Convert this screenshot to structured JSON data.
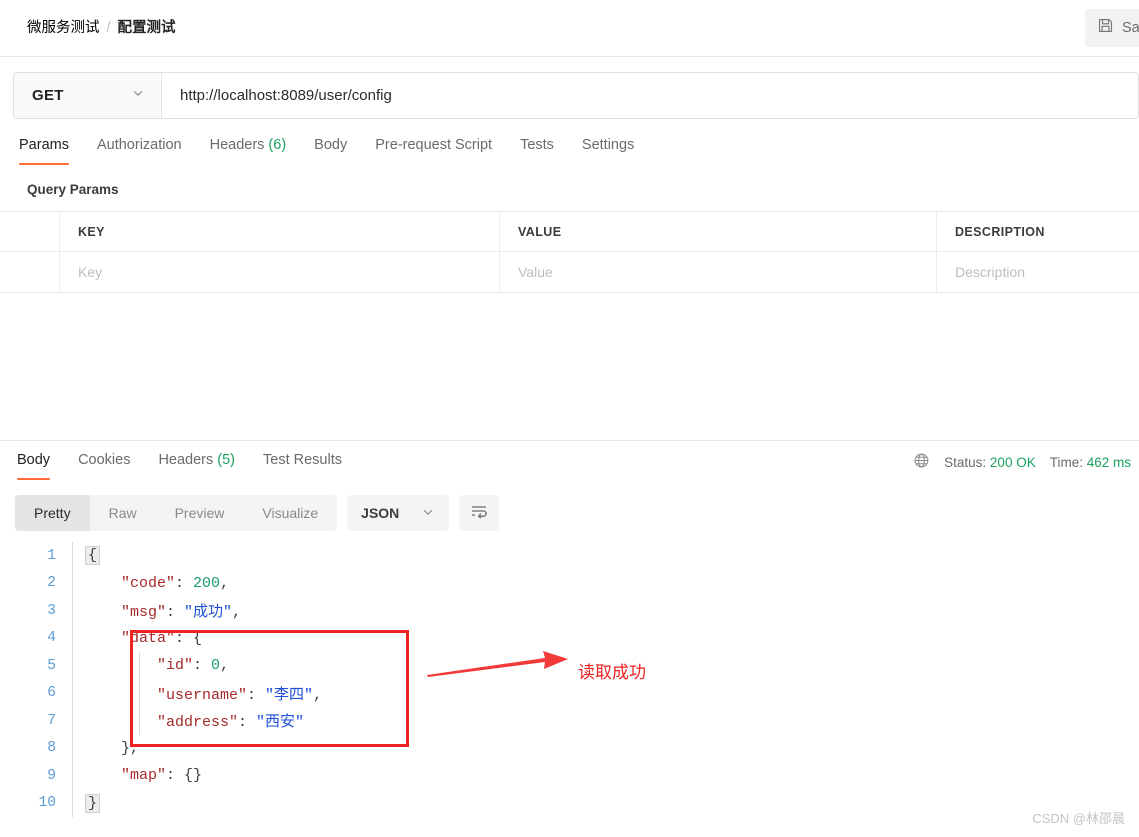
{
  "header": {
    "breadcrumb_parent": "微服务测试",
    "breadcrumb_separator": "/",
    "breadcrumb_current": "配置测试",
    "save_label": "Sa"
  },
  "request": {
    "method": "GET",
    "url": "http://localhost:8089/user/config",
    "tabs": [
      {
        "label": "Params",
        "count": "",
        "active": true
      },
      {
        "label": "Authorization",
        "count": "",
        "active": false
      },
      {
        "label": "Headers",
        "count": "(6)",
        "active": false
      },
      {
        "label": "Body",
        "count": "",
        "active": false
      },
      {
        "label": "Pre-request Script",
        "count": "",
        "active": false
      },
      {
        "label": "Tests",
        "count": "",
        "active": false
      },
      {
        "label": "Settings",
        "count": "",
        "active": false
      }
    ],
    "query_params": {
      "title": "Query Params",
      "columns": [
        "KEY",
        "VALUE",
        "DESCRIPTION"
      ],
      "rows": [
        {
          "key": "Key",
          "value": "Value",
          "description": "Description"
        }
      ]
    }
  },
  "response": {
    "tabs": [
      {
        "label": "Body",
        "count": "",
        "active": true
      },
      {
        "label": "Cookies",
        "count": "",
        "active": false
      },
      {
        "label": "Headers",
        "count": "(5)",
        "active": false
      },
      {
        "label": "Test Results",
        "count": "",
        "active": false
      }
    ],
    "status_label": "Status:",
    "status_value": "200 OK",
    "time_label": "Time:",
    "time_value": "462 ms",
    "format_tabs": [
      {
        "label": "Pretty",
        "active": true
      },
      {
        "label": "Raw",
        "active": false
      },
      {
        "label": "Preview",
        "active": false
      },
      {
        "label": "Visualize",
        "active": false
      }
    ],
    "format_select": "JSON",
    "body_lines": [
      {
        "n": "1",
        "segments": [
          {
            "t": "{",
            "c": "brace"
          }
        ]
      },
      {
        "n": "2",
        "segments": [
          {
            "t": "    ",
            "c": "pun"
          },
          {
            "t": "\"code\"",
            "c": "k"
          },
          {
            "t": ": ",
            "c": "pun"
          },
          {
            "t": "200",
            "c": "num"
          },
          {
            "t": ",",
            "c": "pun"
          }
        ]
      },
      {
        "n": "3",
        "segments": [
          {
            "t": "    ",
            "c": "pun"
          },
          {
            "t": "\"msg\"",
            "c": "k"
          },
          {
            "t": ": ",
            "c": "pun"
          },
          {
            "t": "\"成功\"",
            "c": "str"
          },
          {
            "t": ",",
            "c": "pun"
          }
        ]
      },
      {
        "n": "4",
        "segments": [
          {
            "t": "    ",
            "c": "pun"
          },
          {
            "t": "\"data\"",
            "c": "k"
          },
          {
            "t": ": {",
            "c": "pun"
          }
        ]
      },
      {
        "n": "5",
        "segments": [
          {
            "t": "        ",
            "c": "pun"
          },
          {
            "t": "\"id\"",
            "c": "k"
          },
          {
            "t": ": ",
            "c": "pun"
          },
          {
            "t": "0",
            "c": "num"
          },
          {
            "t": ",",
            "c": "pun"
          }
        ]
      },
      {
        "n": "6",
        "segments": [
          {
            "t": "        ",
            "c": "pun"
          },
          {
            "t": "\"username\"",
            "c": "k"
          },
          {
            "t": ": ",
            "c": "pun"
          },
          {
            "t": "\"李四\"",
            "c": "str"
          },
          {
            "t": ",",
            "c": "pun"
          }
        ]
      },
      {
        "n": "7",
        "segments": [
          {
            "t": "        ",
            "c": "pun"
          },
          {
            "t": "\"address\"",
            "c": "k"
          },
          {
            "t": ": ",
            "c": "pun"
          },
          {
            "t": "\"西安\"",
            "c": "str"
          }
        ]
      },
      {
        "n": "8",
        "segments": [
          {
            "t": "    },",
            "c": "pun"
          }
        ]
      },
      {
        "n": "9",
        "segments": [
          {
            "t": "    ",
            "c": "pun"
          },
          {
            "t": "\"map\"",
            "c": "k"
          },
          {
            "t": ": {}",
            "c": "pun"
          }
        ]
      },
      {
        "n": "10",
        "segments": [
          {
            "t": "}",
            "c": "brace"
          }
        ]
      }
    ]
  },
  "annotation": {
    "label": "读取成功",
    "color": "#ee2222"
  },
  "watermark": "CSDN @林邵晨"
}
